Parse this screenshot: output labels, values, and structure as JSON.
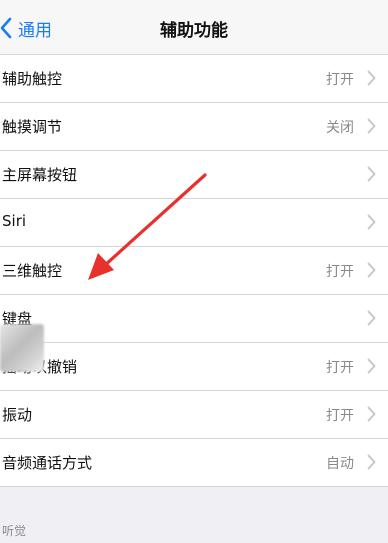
{
  "nav": {
    "back_label": "通用",
    "title": "辅助功能"
  },
  "settings": [
    {
      "label": "辅助触控",
      "value": "打开"
    },
    {
      "label": "触摸调节",
      "value": "关闭"
    },
    {
      "label": "主屏幕按钮",
      "value": ""
    },
    {
      "label": "Siri",
      "value": ""
    },
    {
      "label": "三维触控",
      "value": "打开"
    },
    {
      "label": "键盘",
      "value": ""
    },
    {
      "label": "摇动以撤销",
      "value": "打开"
    },
    {
      "label": "振动",
      "value": "打开"
    },
    {
      "label": "音频通话方式",
      "value": "自动"
    }
  ],
  "section_header": "听觉",
  "icons": {
    "back": "chevron-left-icon",
    "disclosure": "chevron-right-icon"
  },
  "colors": {
    "accent": "#1a7cf5",
    "annotation_arrow": "#e8302c",
    "background": "#efeff4"
  }
}
